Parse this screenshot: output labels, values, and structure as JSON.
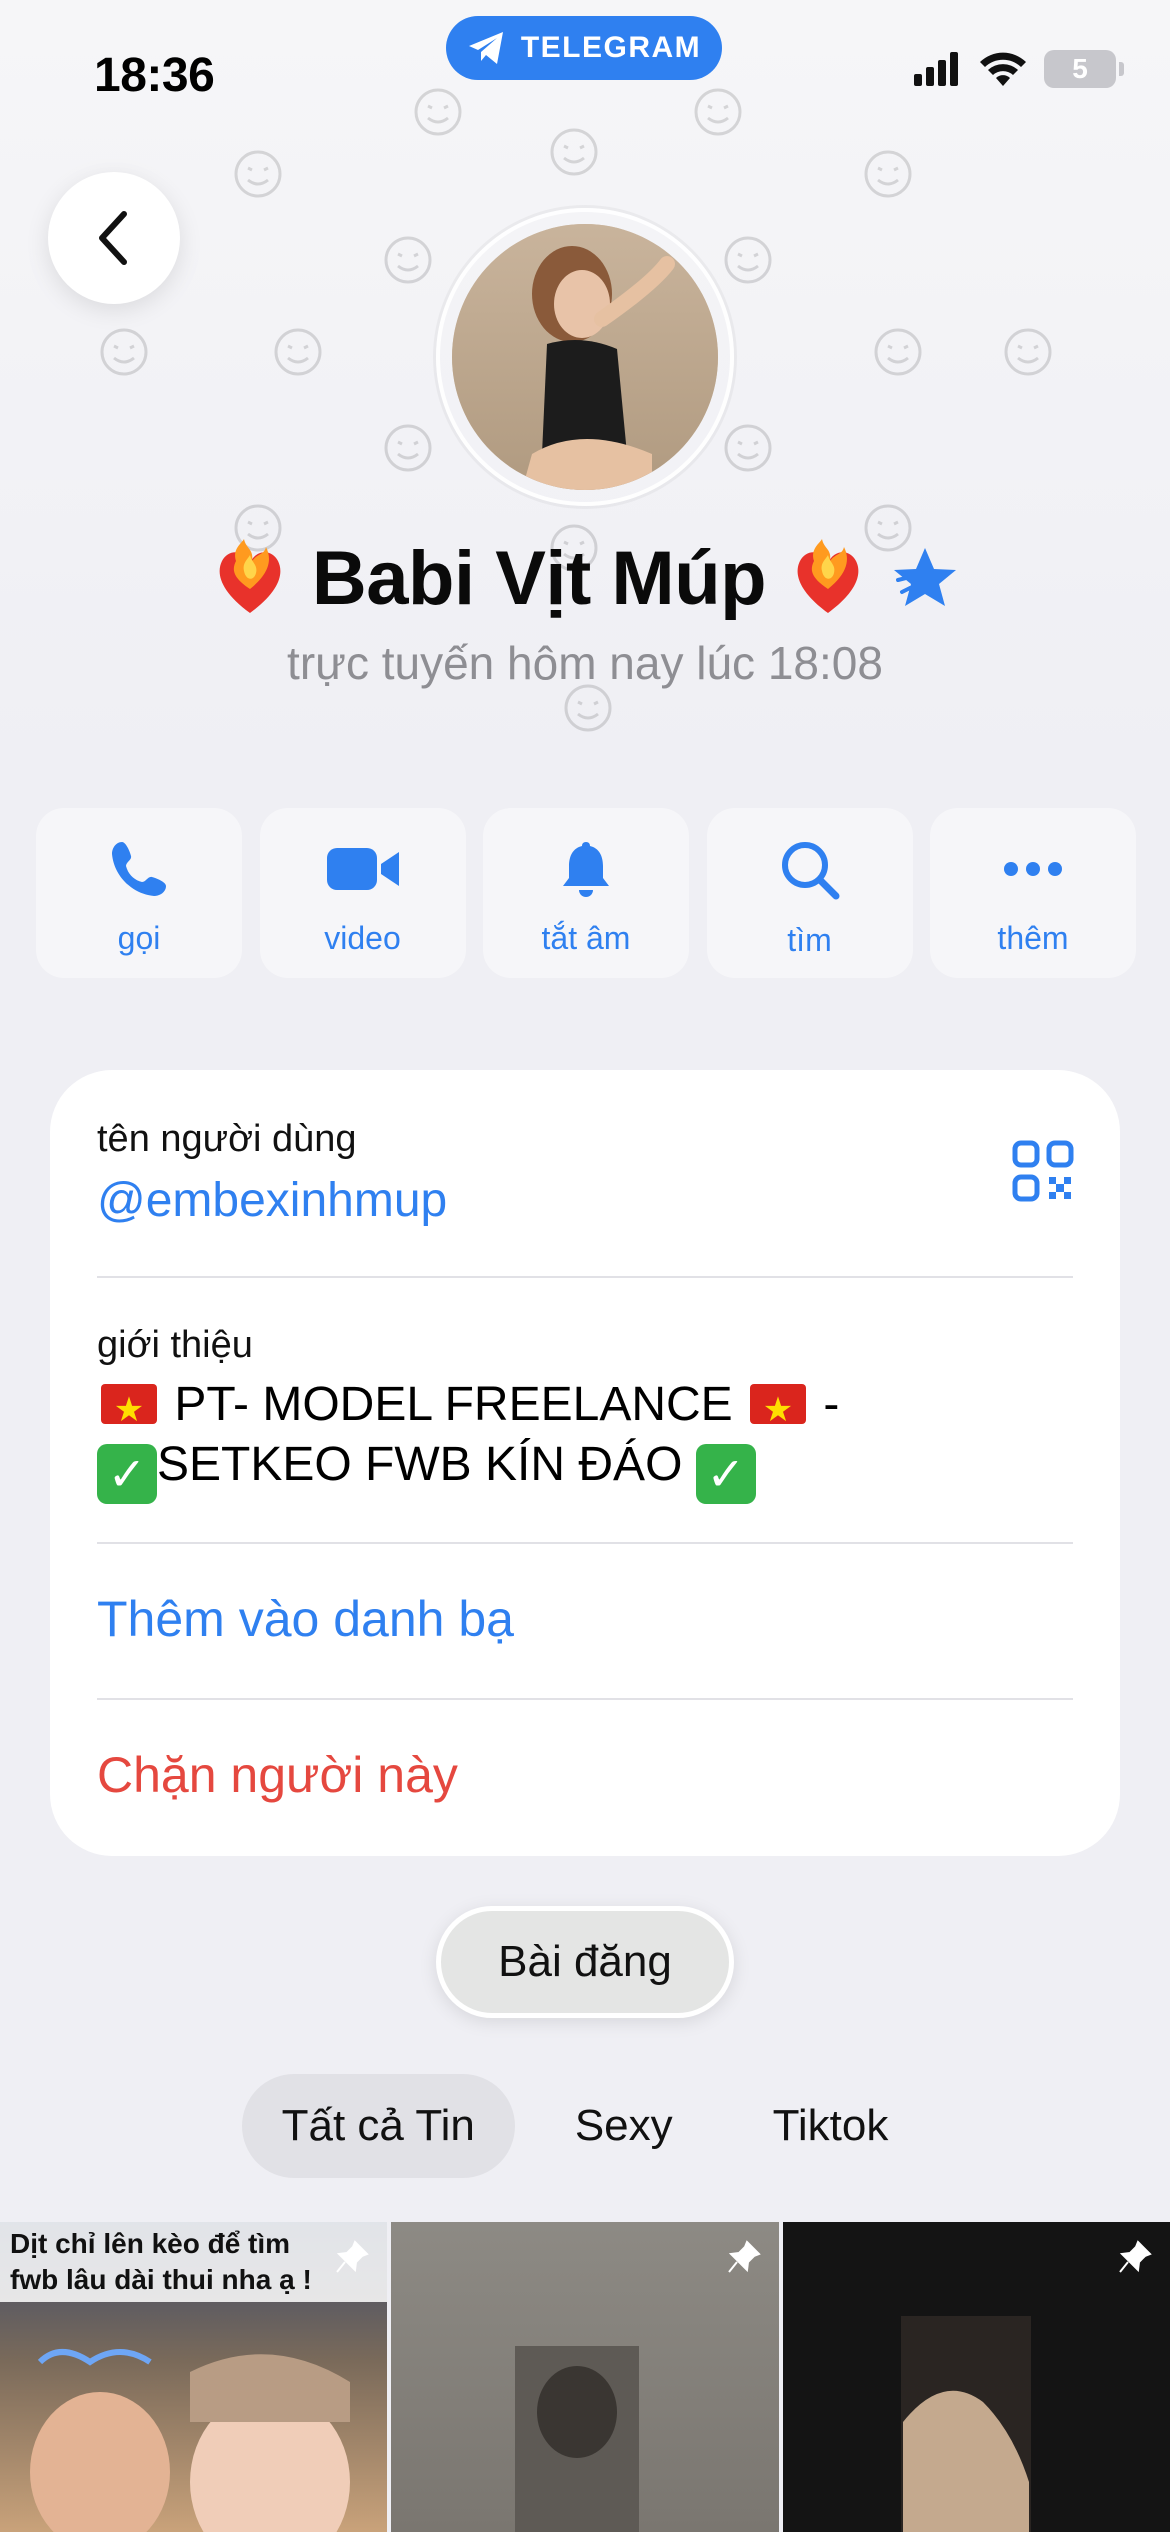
{
  "status_bar": {
    "time": "18:36",
    "app_pill": "TELEGRAM",
    "battery": "5"
  },
  "profile": {
    "name": "Babi Vịt Múp",
    "status": "trực tuyến hôm nay lúc 18:08",
    "accent_color": "#2f80f0"
  },
  "actions": [
    {
      "label": "gọi",
      "icon": "phone-icon"
    },
    {
      "label": "video",
      "icon": "video-camera-icon"
    },
    {
      "label": "tắt âm",
      "icon": "bell-icon"
    },
    {
      "label": "tìm",
      "icon": "search-icon"
    },
    {
      "label": "thêm",
      "icon": "more-icon"
    }
  ],
  "info": {
    "username_label": "tên người dùng",
    "username": "@embexinhmup",
    "bio_label": "giới thiệu",
    "bio_line1_text": "PT- MODEL FREELANCE",
    "bio_line1_suffix": "-",
    "bio_line2_text": "SETKEO FWB KÍN ĐÁO",
    "add_contact": "Thêm vào danh bạ",
    "block": "Chặn người này",
    "danger_color": "#e5483f"
  },
  "posts_pill": "Bài đăng",
  "tabs": [
    "Tất cả Tin",
    "Sexy",
    "Tiktok"
  ],
  "media": {
    "tile1_caption_1": "Dịt chỉ lên kèo để tìm",
    "tile1_caption_2": "fwb lâu dài thui nha ạ !"
  }
}
